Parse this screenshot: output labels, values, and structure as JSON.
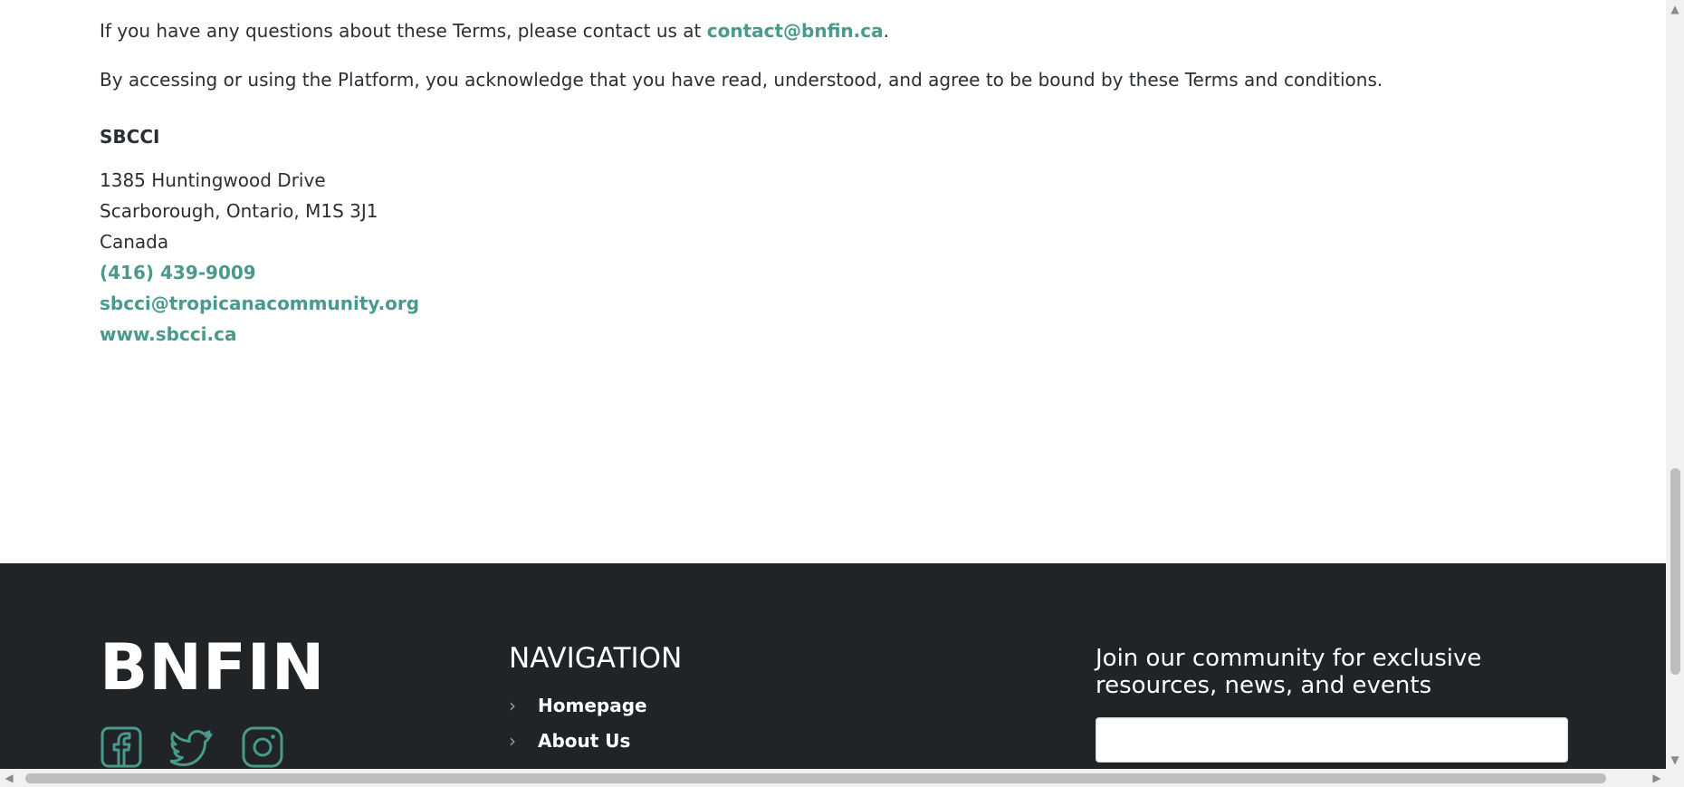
{
  "content": {
    "para1_prefix": "If you have any questions about these Terms, please contact us at ",
    "para1_email": "contact@bnfin.ca",
    "para1_suffix": ".",
    "para2": "By accessing or using the Platform, you acknowledge that you have read, understood, and agree to be bound by these Terms and conditions.",
    "org_title": "SBCCI",
    "address_lines": [
      "1385 Huntingwood Drive",
      "Scarborough, Ontario, M1S 3J1",
      "Canada"
    ],
    "phone": "(416) 439-9009",
    "email": "sbcci@tropicanacommunity.org",
    "website": "www.sbcci.ca"
  },
  "footer": {
    "logo": "BNFIN",
    "social_icons": [
      "facebook-icon",
      "twitter-icon",
      "instagram-icon"
    ],
    "nav_title": "NAVIGATION",
    "nav_items": [
      "Homepage",
      "About Us"
    ],
    "newsletter_title": "Join our community for exclusive resources, news, and events",
    "newsletter_placeholder": ""
  },
  "colors": {
    "accent": "#4a9a8c",
    "footer_bg": "#212427",
    "text": "#2b2f33"
  }
}
